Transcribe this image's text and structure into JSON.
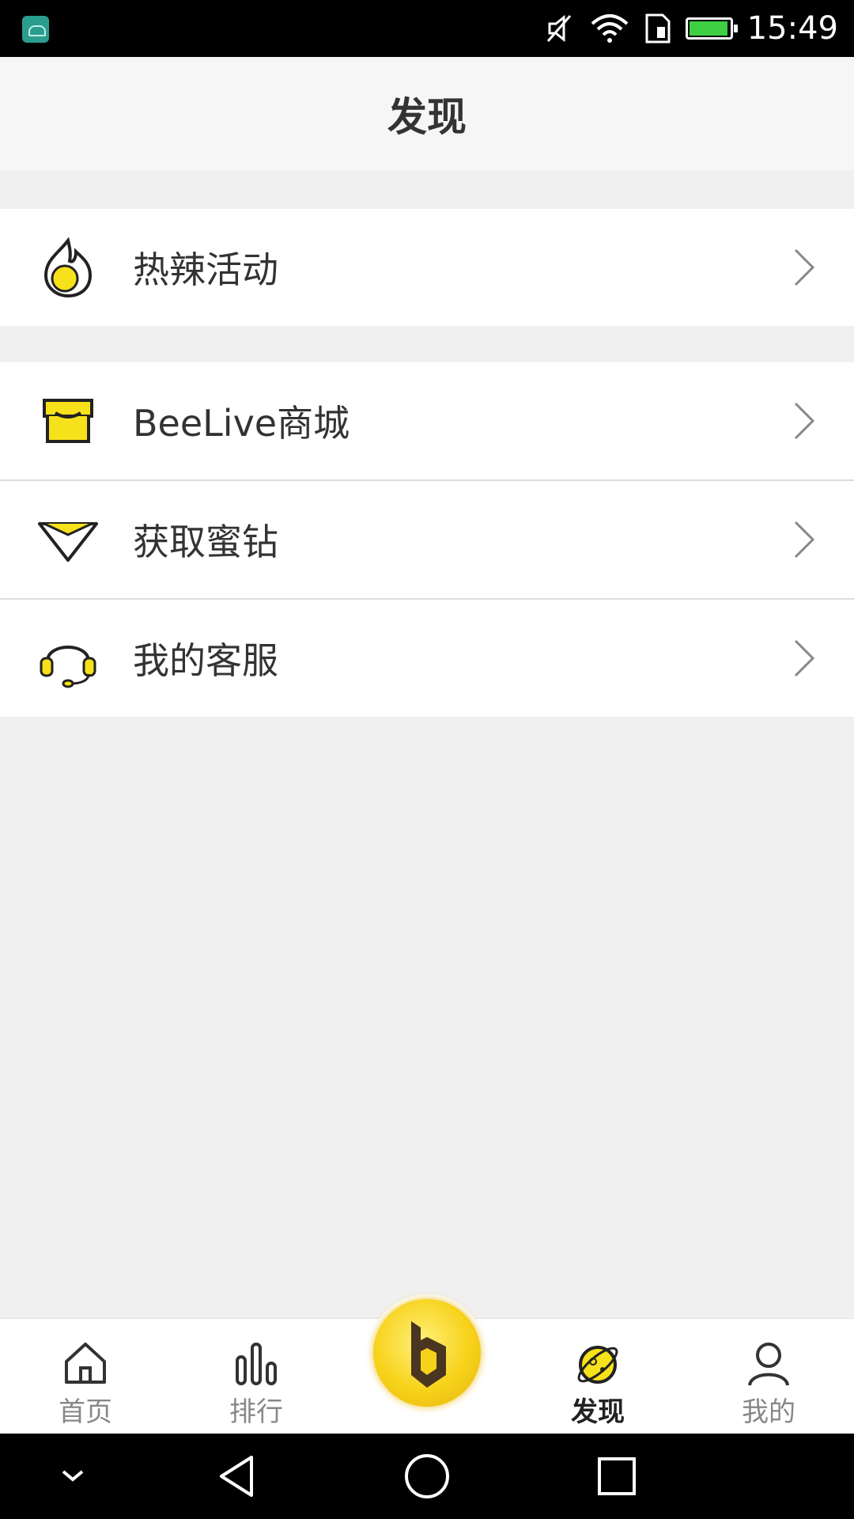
{
  "status_bar": {
    "time": "15:49"
  },
  "header": {
    "title": "发现"
  },
  "menu": {
    "items": [
      {
        "label": "热辣活动",
        "icon": "flame-icon"
      },
      {
        "label": "BeeLive商城",
        "icon": "shop-icon"
      },
      {
        "label": "获取蜜钻",
        "icon": "diamond-icon"
      },
      {
        "label": "我的客服",
        "icon": "headset-icon"
      }
    ]
  },
  "tabbar": {
    "tabs": [
      {
        "label": "首页",
        "icon": "home-icon",
        "active": false
      },
      {
        "label": "排行",
        "icon": "ranking-icon",
        "active": false
      },
      {
        "label": "发现",
        "icon": "planet-icon",
        "active": true
      },
      {
        "label": "我的",
        "icon": "profile-icon",
        "active": false
      }
    ],
    "center_button_icon": "beelive-logo-icon"
  },
  "colors": {
    "accent_yellow": "#f7d21a",
    "background": "#f0f0f0",
    "text_primary": "#333333"
  }
}
